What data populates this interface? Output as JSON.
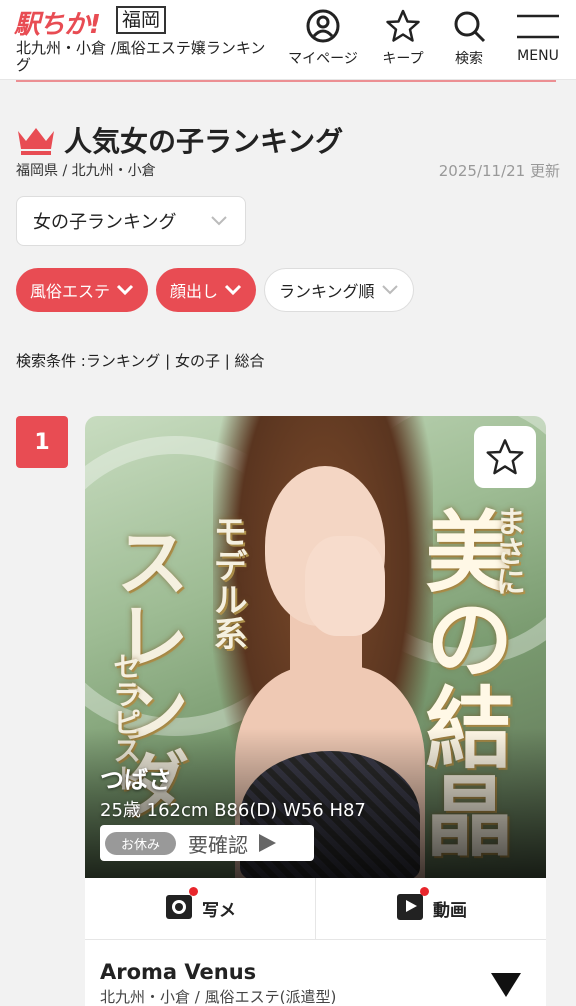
{
  "header": {
    "logo": "駅ちか!",
    "prefecture": "福岡",
    "subtitle": "北九州・小倉 /風俗エステ嬢ランキング",
    "nav": [
      {
        "label": "マイページ",
        "icon": "user-circle-icon"
      },
      {
        "label": "キープ",
        "icon": "star-outline-icon"
      },
      {
        "label": "検索",
        "icon": "search-icon"
      },
      {
        "label": "MENU",
        "icon": "hamburger-menu-icon"
      }
    ]
  },
  "page": {
    "title": "人気女の子ランキング",
    "area": "福岡県 / 北九州・小倉",
    "updated": "2025/11/21 更新"
  },
  "select": {
    "value": "女の子ランキング"
  },
  "filters": [
    {
      "label": "風俗エステ",
      "style": "active"
    },
    {
      "label": "顔出し",
      "style": "active"
    },
    {
      "label": "ランキング順",
      "style": "default"
    }
  ],
  "conditions": "検索条件 :ランキング | 女の子 | 総合",
  "ranking": [
    {
      "rank": "1",
      "name": "つばさ",
      "specs": "25歳 162cm B86(D) W56 H87",
      "status_badge": "お休み",
      "status_text": "要確認",
      "photo_text": {
        "main": "美の結晶",
        "small": "まさに",
        "mid": "モデル系",
        "left": "スレンダ",
        "left2": "セラピスト"
      },
      "media": {
        "photo_label": "写メ",
        "video_label": "動画"
      },
      "shop_name": "Aroma Venus",
      "shop_area": "北九州・小倉 / 風俗エステ(派遣型)"
    }
  ],
  "colors": {
    "accent": "#e84c53",
    "background": "#f2f2f2",
    "badge_gray": "#999999"
  }
}
